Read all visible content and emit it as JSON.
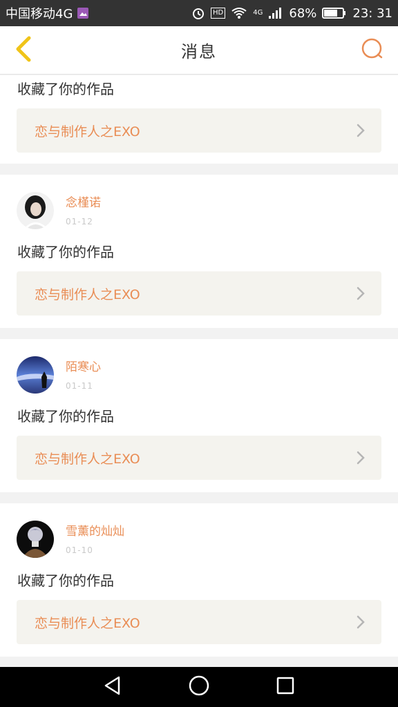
{
  "status_bar": {
    "carrier": "中国移动4G",
    "hd_badge": "HD",
    "network": "4G",
    "battery_percent": "68%",
    "time": "23: 31",
    "icons": [
      "image-icon",
      "alarm-icon",
      "wifi-icon",
      "signal-icon",
      "battery-icon"
    ]
  },
  "header": {
    "title": "消息",
    "back_icon": "chevron-left-icon",
    "search_icon": "search-icon",
    "accent_color": "#e98d55",
    "back_color": "#f0c419"
  },
  "messages": [
    {
      "action": "收藏了你的作品",
      "work_title": "恋与制作人之EXO"
    },
    {
      "user": "念槿诺",
      "date": "01-12",
      "action": "收藏了你的作品",
      "work_title": "恋与制作人之EXO"
    },
    {
      "user": "陌寒心",
      "date": "01-11",
      "action": "收藏了你的作品",
      "work_title": "恋与制作人之EXO"
    },
    {
      "user": "雪薰的灿灿",
      "date": "01-10",
      "action": "收藏了你的作品",
      "work_title": "恋与制作人之EXO"
    }
  ],
  "nav_bar": {
    "icons": [
      "back-triangle-icon",
      "home-circle-icon",
      "recents-square-icon"
    ]
  }
}
